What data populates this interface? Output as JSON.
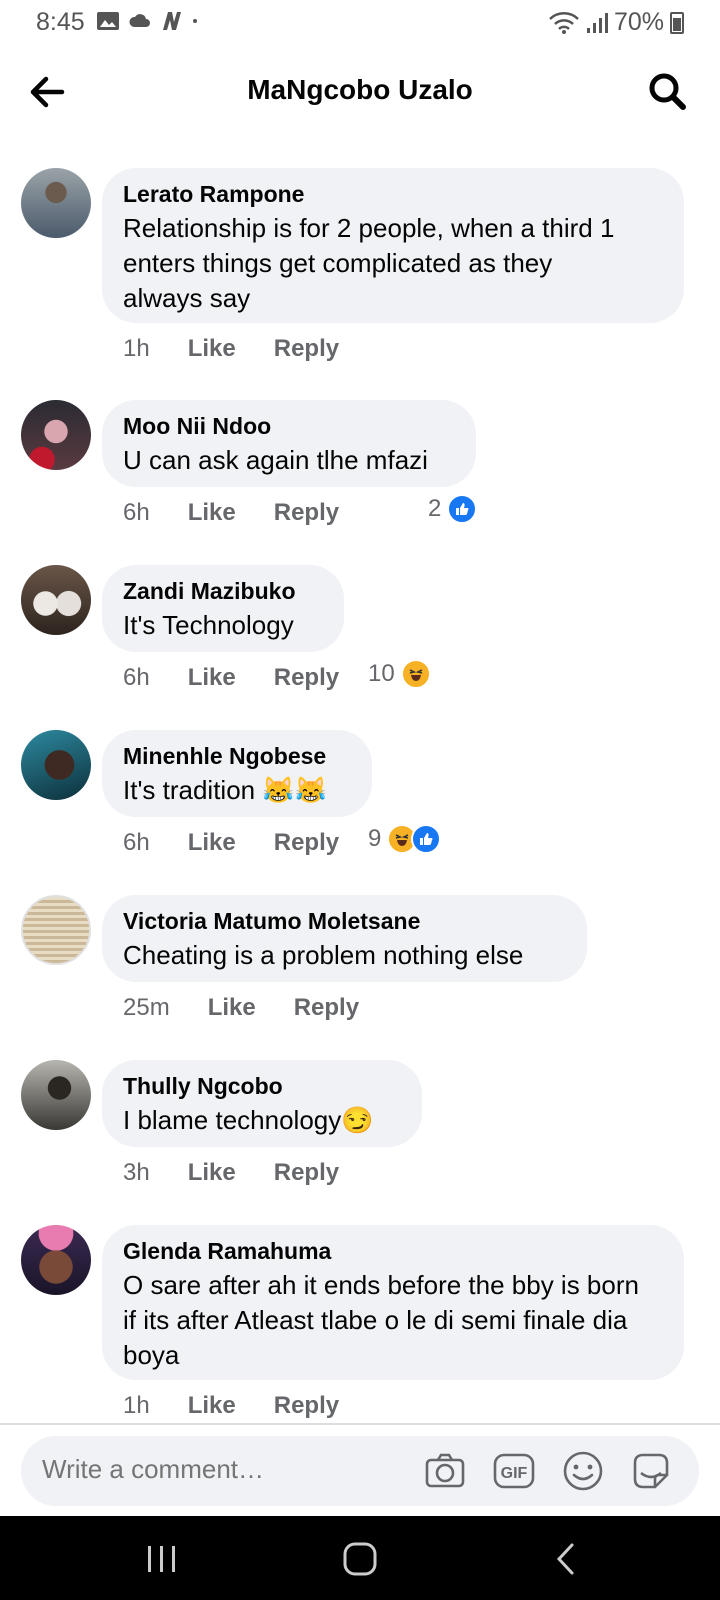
{
  "status_bar": {
    "time": "8:45",
    "battery": "70%"
  },
  "header": {
    "title": "MaNgcobo Uzalo"
  },
  "comments": [
    {
      "author": "Lerato Rampone",
      "lines": [
        "Relationship is for 2 people, when a third 1",
        "enters things get complicated as they",
        "always say"
      ],
      "time": "1h",
      "like": "Like",
      "reply": "Reply",
      "reaction_count": "",
      "reactions": []
    },
    {
      "author": "Moo Nii Ndoo",
      "lines": [
        "U can ask again tlhe mfazi"
      ],
      "time": "6h",
      "like": "Like",
      "reply": "Reply",
      "reaction_count": "2",
      "reactions": [
        "like"
      ]
    },
    {
      "author": "Zandi Mazibuko",
      "lines": [
        "It's Technology"
      ],
      "time": "6h",
      "like": "Like",
      "reply": "Reply",
      "reaction_count": "10",
      "reactions": [
        "haha"
      ]
    },
    {
      "author": "Minenhle Ngobese",
      "lines": [
        "It's tradition 😹😹"
      ],
      "time": "6h",
      "like": "Like",
      "reply": "Reply",
      "reaction_count": "9",
      "reactions": [
        "haha",
        "like"
      ]
    },
    {
      "author": "Victoria Matumo Moletsane",
      "lines": [
        "Cheating is a problem nothing else"
      ],
      "time": "25m",
      "like": "Like",
      "reply": "Reply",
      "reaction_count": "",
      "reactions": []
    },
    {
      "author": "Thully Ngcobo",
      "lines": [
        "I blame technology😏"
      ],
      "time": "3h",
      "like": "Like",
      "reply": "Reply",
      "reaction_count": "",
      "reactions": []
    },
    {
      "author": "Glenda Ramahuma",
      "lines": [
        "O sare after ah it ends before the bby is born",
        "if its after Atleast tlabe o le di semi finale dia",
        "boya"
      ],
      "time": "1h",
      "like": "Like",
      "reply": "Reply",
      "reaction_count": "",
      "reactions": []
    }
  ],
  "composer": {
    "placeholder": "Write a comment…",
    "icons": [
      "camera-icon",
      "gif-icon",
      "emoji-icon",
      "sticker-icon"
    ]
  },
  "nav_bar": {
    "icons": [
      "recent-apps-icon",
      "home-icon",
      "back-icon"
    ]
  },
  "colors": {
    "bubble": "#f0f2f5",
    "secondary_text": "#65676b",
    "like_blue": "#1877f2",
    "haha_yellow": "#f7b125"
  }
}
